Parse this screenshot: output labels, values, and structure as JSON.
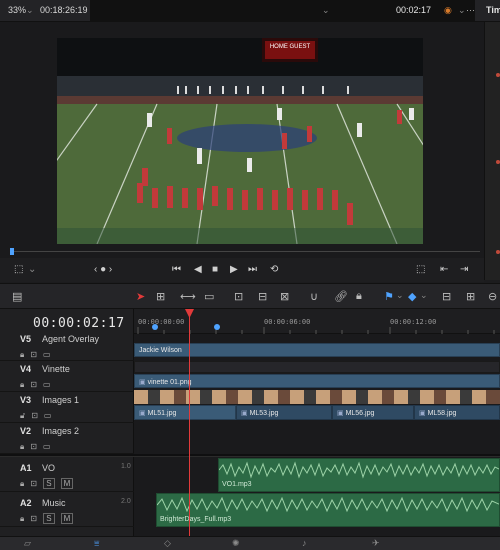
{
  "viewer": {
    "zoom": "33%",
    "source_tc": "00:18:26:19",
    "record_tc": "00:02:17",
    "panel_label": "Tim",
    "more": "···",
    "scoreboard_text": "HOME GUEST"
  },
  "timeline": {
    "current_tc": "00:00:02:17",
    "ruler_ticks": [
      "00:00:00:00",
      "00:00:06:00",
      "00:00:12:00"
    ],
    "tracks": [
      {
        "id": "V5",
        "name": "Agent Overlay",
        "num": ""
      },
      {
        "id": "V4",
        "name": "Vinette",
        "num": ""
      },
      {
        "id": "V3",
        "name": "Images 1",
        "num": ""
      },
      {
        "id": "V2",
        "name": "Images 2",
        "num": ""
      },
      {
        "id": "A1",
        "name": "VO",
        "num": "1.0"
      },
      {
        "id": "A2",
        "name": "Music",
        "num": "2.0"
      }
    ],
    "clips": {
      "v5": "Jackie Wilson",
      "v4": "vinette 01.png",
      "v2": [
        "ML51.jpg",
        "ML53.jpg",
        "ML56.jpg",
        "ML58.jpg"
      ],
      "a1": "VO1.mp3",
      "a2": "BrighterDays_Full.mp3"
    },
    "audio_buttons": {
      "solo": "S",
      "mute": "M"
    }
  },
  "colors": {
    "accent": "#4fa3ff",
    "playhead": "#e23a3a",
    "video_clip": "#3a5b77",
    "audio_clip": "#2c6a45"
  }
}
